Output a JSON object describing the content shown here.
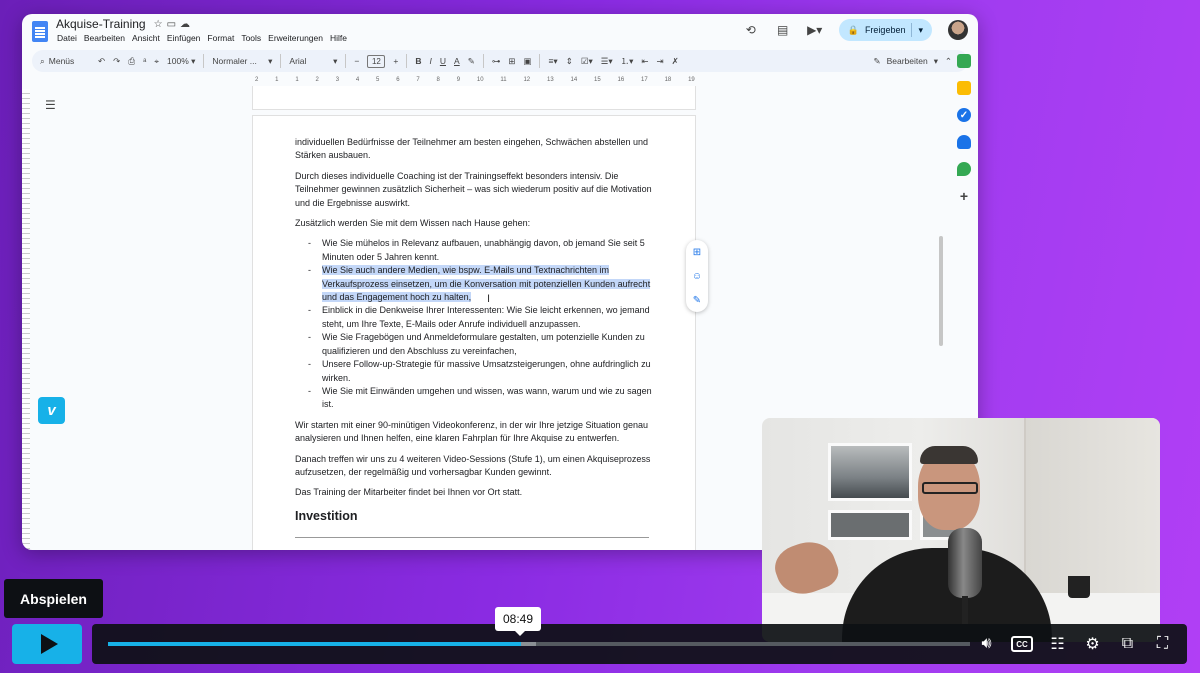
{
  "doc": {
    "title": "Akquise-Training",
    "menu": [
      "Datei",
      "Bearbeiten",
      "Ansicht",
      "Einfügen",
      "Format",
      "Tools",
      "Erweiterungen",
      "Hilfe"
    ],
    "share_label": "Freigeben"
  },
  "toolbar": {
    "search_label": "Menüs",
    "zoom": "100%",
    "style": "Normaler ...",
    "font": "Arial",
    "font_size": "12",
    "edit_mode": "Bearbeiten"
  },
  "ruler": [
    "2",
    "1",
    "1",
    "2",
    "3",
    "4",
    "5",
    "6",
    "7",
    "8",
    "9",
    "10",
    "11",
    "12",
    "13",
    "14",
    "15",
    "16",
    "17",
    "18",
    "19"
  ],
  "content": {
    "p1": "individuellen Bedürfnisse der Teilnehmer am besten eingehen, Schwächen abstellen und Stärken ausbauen.",
    "p2": "Durch dieses individuelle Coaching ist der Trainingseffekt besonders intensiv. Die Teilnehmer gewinnen zusätzlich Sicherheit – was sich wiederum positiv auf die Motivation und die Ergebnisse auswirkt.",
    "p3": "Zusätzlich werden Sie mit dem Wissen nach Hause gehen:",
    "bullets": [
      "Wie Sie mühelos in Relevanz aufbauen, unabhängig davon, ob jemand Sie seit 5 Minuten oder 5 Jahren kennt.",
      "Wie Sie auch andere Medien, wie bspw. E-Mails und Textnachrichten im Verkaufsprozess einsetzen, um die Konversation mit potenziellen Kunden aufrecht und das Engagement hoch zu halten,",
      "Einblick in die Denkweise Ihrer Interessenten: Wie Sie leicht erkennen, wo jemand steht, um Ihre Texte, E-Mails oder Anrufe individuell anzupassen.",
      "Wie Sie Fragebögen und Anmeldeformulare gestalten, um potenzielle Kunden zu qualifizieren und den Abschluss zu vereinfachen,",
      "Unsere Follow-up-Strategie für massive Umsatzsteigerungen, ohne aufdringlich zu wirken.",
      "Wie Sie mit Einwänden umgehen und wissen, was wann, warum und wie zu sagen ist."
    ],
    "p4": "Wir starten mit einer 90-minütigen Videokonferenz, in der wir Ihre jetzige Situation genau analysieren und Ihnen helfen, eine klaren Fahrplan für Ihre Akquise zu entwerfen.",
    "p5": "Danach treffen wir uns zu 4 weiteren Video-Sessions (Stufe 1), um einen Akquiseprozess aufzusetzen, der regelmäßig und vorhersagbar Kunden gewinnt.",
    "p6": "Das Training der Mitarbeiter findet bei Ihnen vor Ort statt.",
    "heading": "Investition"
  },
  "player": {
    "play_tooltip": "Abspielen",
    "time": "08:49",
    "progress": 0.479,
    "loaded": 0.497,
    "accent": "#17b1e8"
  },
  "icons": {
    "vimeo": "v",
    "cc": "CC"
  }
}
